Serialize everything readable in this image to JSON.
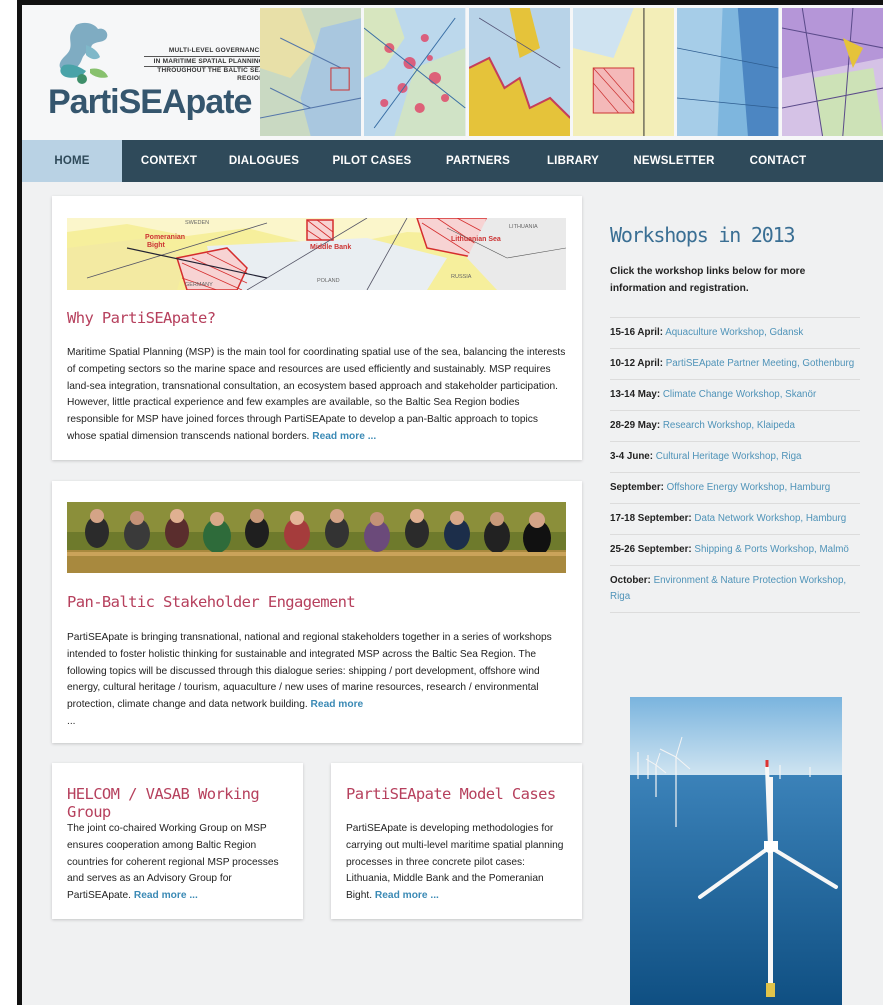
{
  "header": {
    "tagline": [
      "MULTI-LEVEL GOVERNANCE",
      "IN MARITIME SPATIAL PLANNING",
      "THROUGHOUT THE BALTIC SEA REGION"
    ],
    "wordmark_parti": "Parti",
    "wordmark_sea": "SEA",
    "wordmark_pate": "pate"
  },
  "nav": {
    "items": [
      {
        "label": "HOME",
        "active": true
      },
      {
        "label": "CONTEXT",
        "active": false
      },
      {
        "label": "DIALOGUES",
        "active": false
      },
      {
        "label": "PILOT CASES",
        "active": false
      },
      {
        "label": "PARTNERS",
        "active": false
      },
      {
        "label": "LIBRARY",
        "active": false
      },
      {
        "label": "NEWSLETTER",
        "active": false
      },
      {
        "label": "CONTACT",
        "active": false
      }
    ]
  },
  "cards": {
    "why": {
      "map_labels": {
        "sweden": "SWEDEN",
        "pomeranian": "Pomeranian",
        "bight": "Bight",
        "germany": "GERMANY",
        "middle_bank": "Middle Bank",
        "poland": "POLAND",
        "lithuanian_sea": "Lithuanian Sea",
        "lithuania": "LITHUANIA",
        "russia": "RUSSIA"
      },
      "title": "Why PartiSEApate?",
      "body": "Maritime Spatial Planning (MSP) is the main tool for coordinating spatial use of the sea, balancing the interests of competing sectors so the marine space and resources are used efficiently and sustainably. MSP requires land-sea integration, transnational consultation, an ecosystem based approach and stakeholder participation. However, little practical experience and few examples are available, so the Baltic Sea Region bodies responsible for MSP have joined forces through PartiSEApate to develop a pan-Baltic approach to topics whose spatial dimension transcends national borders.",
      "read_more": "Read more ..."
    },
    "stakeholder": {
      "title": "Pan-Baltic Stakeholder Engagement",
      "body": "PartiSEApate is bringing transnational, national and regional stakeholders together in a series of workshops intended to foster holistic thinking for sustainable and integrated MSP across the Baltic Sea Region. The following topics will be discussed through this dialogue series: shipping / port development, offshore wind energy, cultural heritage / tourism, aquaculture / new uses of marine resources, research / environmental protection, climate change and data network building.",
      "read_more": "Read more",
      "ellipsis": "..."
    },
    "helcom": {
      "title": "HELCOM / VASAB Working Group",
      "body": "The joint co-chaired Working Group on MSP ensures cooperation among Baltic Region countries for coherent regional MSP processes and serves as an Advisory Group for PartiSEApate.",
      "read_more": "Read more ..."
    },
    "model": {
      "title": "PartiSEApate Model Cases",
      "body": "PartiSEApate is developing  methodologies for carrying out multi-level maritime spatial planning processes in three concrete pilot cases: Lithuania, Middle Bank and the Pomeranian Bight.",
      "read_more": "Read more ..."
    }
  },
  "sidebar": {
    "title": "Workshops in 2013",
    "intro": "Click the workshop links below for more information and registration.",
    "workshops": [
      {
        "date": "15-16 April:",
        "link": "Aquaculture Workshop, Gdansk"
      },
      {
        "date": "10-12 April:",
        "link": "PartiSEApate Partner Meeting, Gothenburg"
      },
      {
        "date": "13-14 May:",
        "link": "Climate Change Workshop, Skanör"
      },
      {
        "date": "28-29 May:",
        "link": "Research Workshop, Klaipeda"
      },
      {
        "date": "3-4 June:",
        "link": "Cultural Heritage Workshop, Riga"
      },
      {
        "date": "September:",
        "link": "Offshore Energy Workshop, Hamburg"
      },
      {
        "date": "17-18 September:",
        "link": "Data Network Workshop, Hamburg"
      },
      {
        "date": "25-26 September:",
        "link": "Shipping & Ports Workshop, Malmö"
      },
      {
        "date": "October:",
        "link": "Environment & Nature Protection Workshop, Riga"
      }
    ]
  },
  "colors": {
    "nav_bg": "#2f4a5a",
    "nav_active": "#b9d2e4",
    "title_red": "#b6405d",
    "link_blue": "#3b8ab5",
    "sidebar_title": "#3a6f94"
  }
}
